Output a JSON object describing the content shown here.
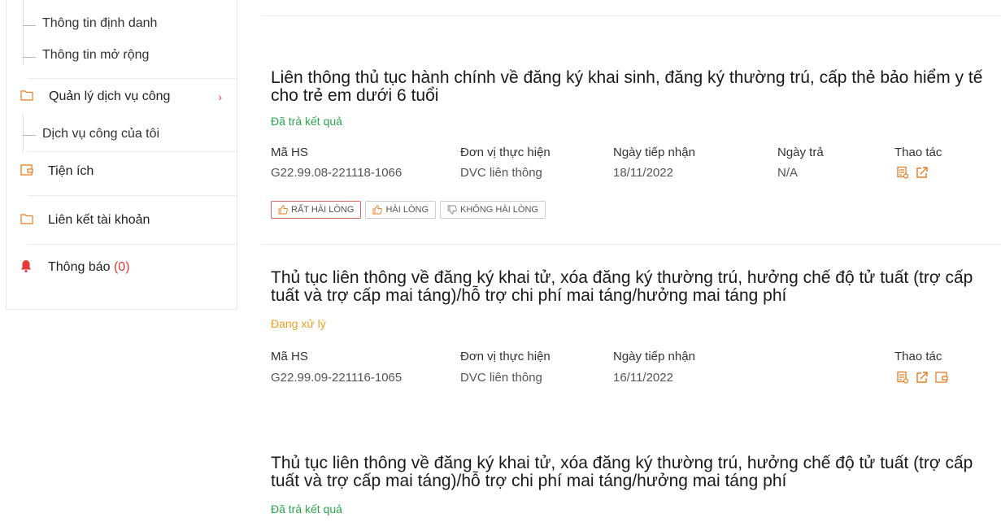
{
  "sidebar": {
    "sub_items": [
      "Thông tin định danh",
      "Thông tin mở rộng"
    ],
    "items": [
      {
        "label": "Quản lý dịch vụ công",
        "icon": "folder-icon",
        "chevron": "›"
      },
      {
        "label": "Dịch vụ công của tôi"
      },
      {
        "label": "Tiện ích",
        "icon": "wallet-icon"
      },
      {
        "label": "Liên kết tài khoản",
        "icon": "folder-icon"
      },
      {
        "label": "Thông báo",
        "count": "(0)",
        "icon": "bell-icon"
      }
    ]
  },
  "columns": {
    "code": "Mã HS",
    "unit": "Đơn vị thực hiện",
    "received": "Ngày tiếp nhận",
    "returned": "Ngày trả",
    "actions": "Thao tác"
  },
  "records": [
    {
      "title": "Liên thông thủ tục hành chính về đăng ký khai sinh, đăng ký thường trú, cấp thẻ bảo hiểm y tế cho trẻ em dưới 6 tuổi",
      "status": "Đã trả kết quả",
      "code": "G22.99.08-221118-1066",
      "unit": "DVC liên thông",
      "received": "18/11/2022",
      "returned": "N/A",
      "ratings": [
        "RẤT HÀI LÒNG",
        "HÀI LÒNG",
        "KHÔNG HÀI LÒNG"
      ]
    },
    {
      "title": "Thủ tục liên thông về đăng ký khai tử, xóa đăng ký thường trú, hưởng chế độ tử tuất (trợ cấp tuất và trợ cấp mai táng)/hỗ trợ chi phí mai táng/hưởng mai táng phí",
      "status": "Đang xử lý",
      "code": "G22.99.09-221116-1065",
      "unit": "DVC liên thông",
      "received": "16/11/2022"
    },
    {
      "title": "Thủ tục liên thông về đăng ký khai tử, xóa đăng ký thường trú, hưởng chế độ tử tuất (trợ cấp tuất và trợ cấp mai táng)/hỗ trợ chi phí mai táng/hưởng mai táng phí",
      "status": "Đã trả kết quả"
    }
  ],
  "colors": {
    "done": "#2ea44f",
    "processing": "#f0a020",
    "accent": "#e74c3c"
  }
}
